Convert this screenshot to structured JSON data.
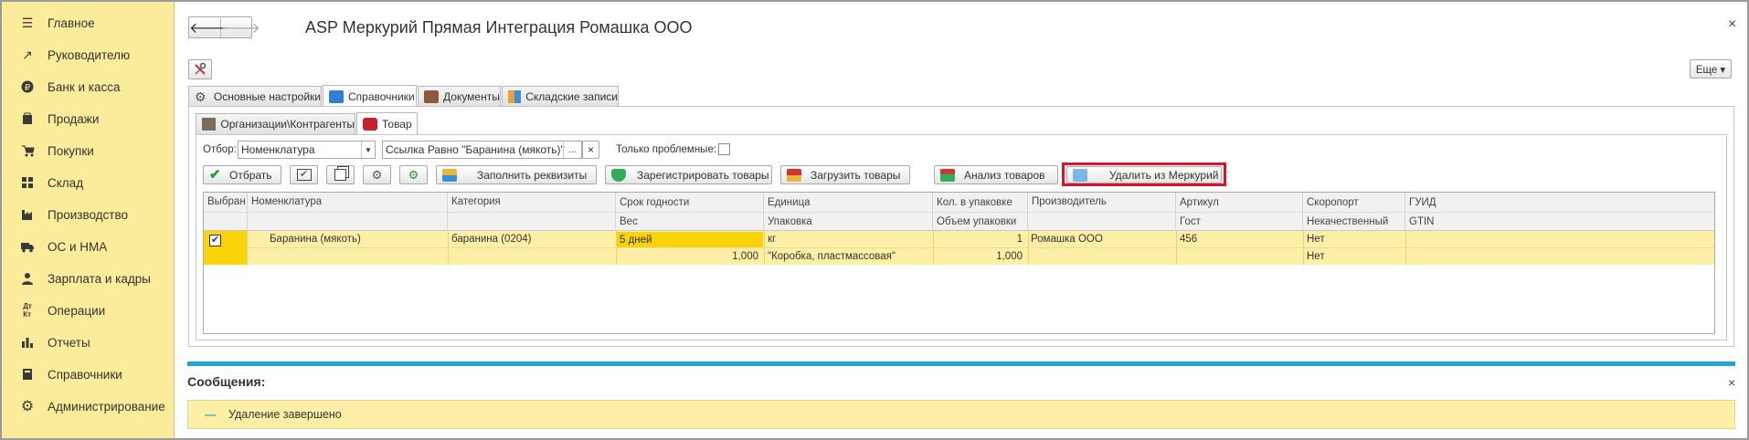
{
  "sidebar": {
    "items": [
      {
        "label": "Главное",
        "icon": "menu-icon"
      },
      {
        "label": "Руководителю",
        "icon": "trend-icon"
      },
      {
        "label": "Банк и касса",
        "icon": "ruble-icon"
      },
      {
        "label": "Продажи",
        "icon": "sales-icon"
      },
      {
        "label": "Покупки",
        "icon": "cart-icon"
      },
      {
        "label": "Склад",
        "icon": "warehouse-icon"
      },
      {
        "label": "Производство",
        "icon": "factory-icon"
      },
      {
        "label": "ОС и НМА",
        "icon": "truck-icon"
      },
      {
        "label": "Зарплата и кадры",
        "icon": "person-icon"
      },
      {
        "label": "Операции",
        "icon": "operations-icon"
      },
      {
        "label": "Отчеты",
        "icon": "reports-icon"
      },
      {
        "label": "Справочники",
        "icon": "book-icon"
      },
      {
        "label": "Администрирование",
        "icon": "gear-icon"
      }
    ]
  },
  "window": {
    "title": "ASP Меркурий Прямая Интеграция Ромашка ООО",
    "close": "×",
    "more": "Еще ▾"
  },
  "tabs_main": [
    "Основные настройки",
    "Справочники",
    "Документы",
    "Складские записи"
  ],
  "tabs_sub": [
    "Организации\\Контрагенты",
    "Товар"
  ],
  "filter": {
    "label": "Отбор:",
    "value": "Номенклатура",
    "link": "Ссылка Равно \"Баранина (мякоть)\"",
    "ellipsis": "...",
    "clear": "×",
    "problems_label": "Только проблемные:"
  },
  "toolbar": {
    "select": "Отбрать",
    "fill": "Заполнить реквизиты",
    "register": "Зарегистрировать товары",
    "load": "Загрузить товары",
    "analysis": "Анализ товаров",
    "delete": "Удалить из Меркурий"
  },
  "table": {
    "headers_top": [
      "Выбран",
      "Номенклатура",
      "Категория",
      "Срок годности",
      "Единица",
      "Кол. в упаковке",
      "Производитель",
      "Артикул",
      "Скоропорт",
      "ГУИД"
    ],
    "headers_bottom": [
      "",
      "",
      "",
      "Вес",
      "Упаковка",
      "Объем упаковки",
      "",
      "Гост",
      "Некачественный",
      "GTIN"
    ],
    "row": {
      "nomenclature": "Баранина (мякоть)",
      "category": "баранина (0204)",
      "shelf": "5 дней",
      "unit": "кг",
      "qty": "1",
      "producer": "Ромашка ООО",
      "article": "456",
      "perishable": "Нет",
      "weight": "1,000",
      "package": "\"Коробка, пластмассовая\"",
      "volume": "1,000",
      "defective": "Нет"
    }
  },
  "messages": {
    "title": "Сообщения:",
    "close": "×",
    "text": "Удаление завершено",
    "dash": "—"
  },
  "colors": {
    "sidebar": "#fbec9c",
    "accent_bar": "#1fa7cf",
    "highlight_row": "#fdf0a6",
    "shelf_cell": "#f9d40b",
    "red_frame": "#d8142b"
  }
}
